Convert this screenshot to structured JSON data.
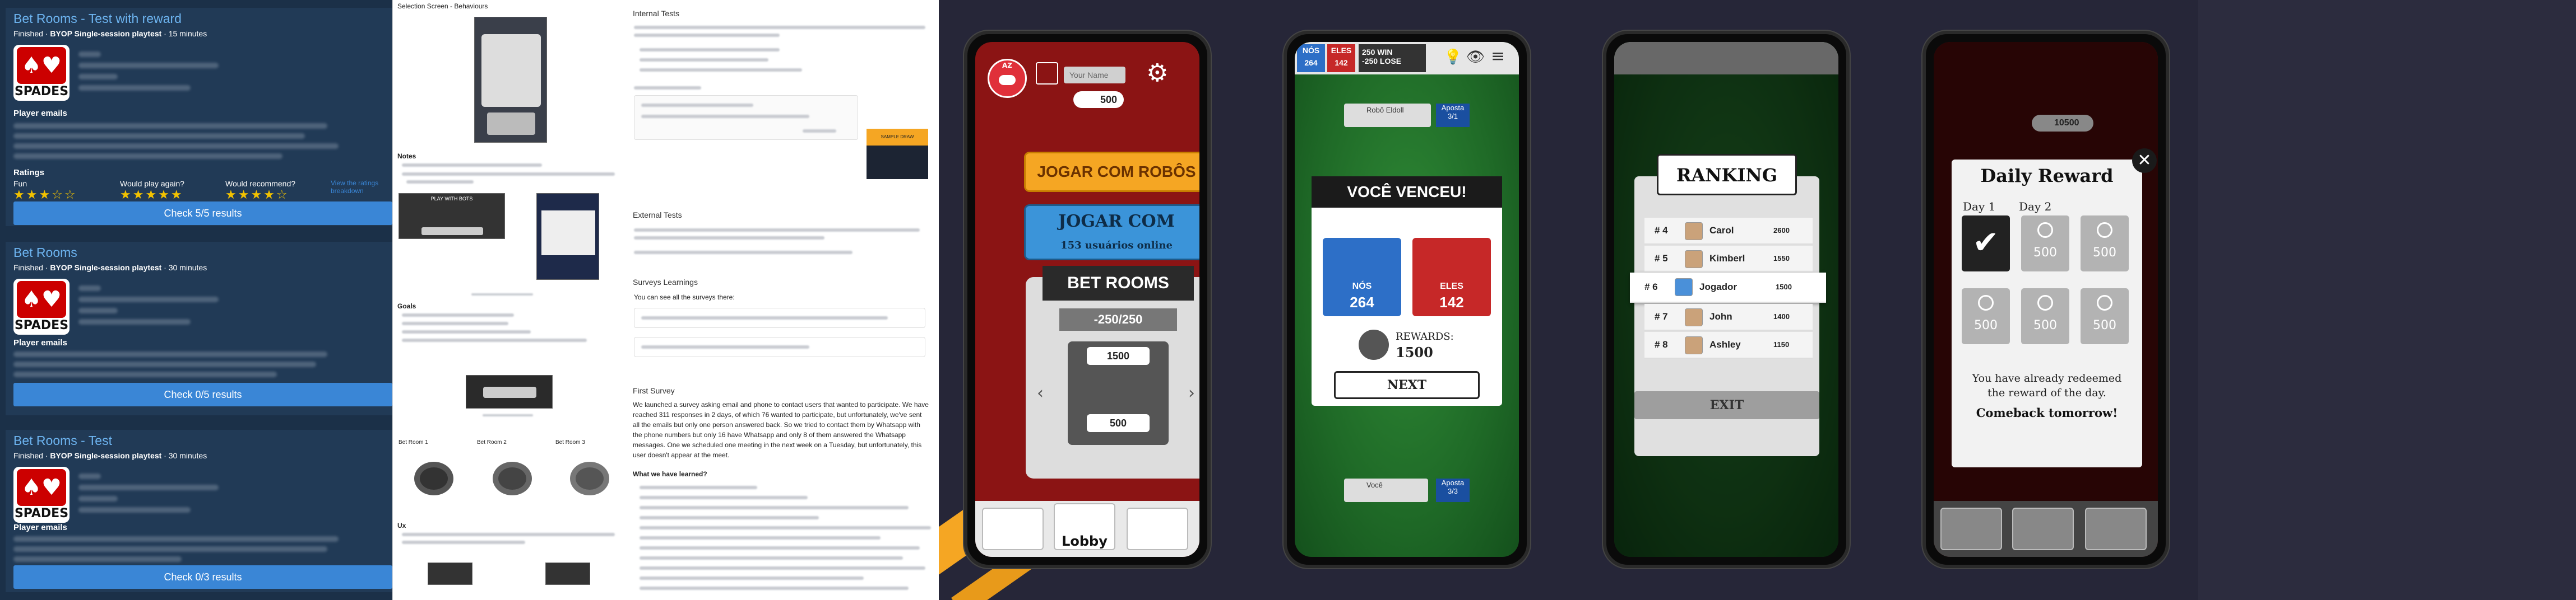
{
  "panel1": {
    "cards": [
      {
        "title": "Bet Rooms - Test with reward",
        "status": "Finished · ",
        "project": "BYOP Single-session playtest",
        "duration": " · 15 minutes",
        "emails_label": "Player emails",
        "has_ratings": true,
        "check": "Check 5/5 results"
      },
      {
        "title": "Bet Rooms",
        "status": "Finished · ",
        "project": "BYOP Single-session playtest",
        "duration": " · 30 minutes",
        "emails_label": "Player emails",
        "has_ratings": false,
        "check": "Check 0/5 results"
      },
      {
        "title": "Bet Rooms - Test",
        "status": "Finished · ",
        "project": "BYOP Single-session playtest",
        "duration": " · 30 minutes",
        "emails_label": "Player emails",
        "has_ratings": false,
        "check": "Check 0/3 results"
      }
    ],
    "logo_text": "SPADES",
    "ratings": {
      "label": "Ratings",
      "fun": "Fun",
      "play_again": "Would play again?",
      "recommend": "Would recommend?",
      "link": "View the ratings breakdown"
    }
  },
  "panel2": {
    "left": {
      "heading": "Selection Screen - Behaviours",
      "notes": "Notes",
      "goals": "Goals",
      "bet_rooms": [
        "Bet Room 1",
        "Bet Room 2",
        "Bet Room 3"
      ],
      "ux": "Ux",
      "mock_label": "PLAY WITH BOTS"
    },
    "right": {
      "internal": "Internal Tests",
      "external": "External Tests",
      "surveys": "Surveys Learnings",
      "surveys_sub": "You can see all the surveys there:",
      "first_survey": "First Survey",
      "first_text": "We launched a survey asking email and phone to contact users that wanted to participate. We have reached 311 responses in 2 days, of which 76 wanted to participate, but unfortunately, we've sent all the emails but only one person answered back. So we tried to contact them by Whatsapp with the phone numbers but only 16 have Whatsapp and only 8 of them answered the Whatsapp messages. One we scheduled one meeting in the next week on a Tuesday, but unfortunately, this user doesn't appear at the meet.",
      "learned": "What we have learned?",
      "sidebox": "SAMPLE DRAW"
    }
  },
  "phone1": {
    "your_name": "Your Name",
    "coins": "500",
    "play_bots": "JOGAR COM ROBÔS",
    "play_online": "JOGAR COM",
    "online_count": "153 usuários online",
    "bet_rooms": "BET ROOMS",
    "bet_range": "-250/250",
    "room_bet": "1500",
    "room_cost": "500",
    "lobby": "Lobby",
    "avatar_tag": "AZ"
  },
  "phone2": {
    "nos_label": "NÓS",
    "nos_score": "264",
    "eles_label": "ELES",
    "eles_score": "142",
    "win": "250 WIN",
    "lose": "-250 LOSE",
    "player": "Robô Eldoll",
    "bet": "Aposta",
    "bet_val": "3/1",
    "you_won": "VOCÊ VENCEU!",
    "score_nos": "264",
    "score_eles": "142",
    "rewards_label": "REWARDS:",
    "rewards_val": "1500",
    "next": "NEXT",
    "you": "Você",
    "your_bet": "3/3"
  },
  "phone3": {
    "title": "RANKING",
    "rows": [
      {
        "rank": "# 4",
        "name": "Carol",
        "score": "2600"
      },
      {
        "rank": "# 5",
        "name": "Kimberl",
        "score": "1550"
      },
      {
        "rank": "# 6",
        "name": "Jogador",
        "score": "1500"
      },
      {
        "rank": "# 7",
        "name": "John",
        "score": "1400"
      },
      {
        "rank": "# 8",
        "name": "Ashley",
        "score": "1150"
      }
    ],
    "exit": "EXIT"
  },
  "phone4": {
    "title": "Daily Reward",
    "day1": "Day 1",
    "day2": "Day 2",
    "slot": "500",
    "msg1": "You have already redeemed",
    "msg2": "the reward of the day.",
    "msg3": "Comeback tomorrow!",
    "coins": "10500"
  },
  "colors": {
    "panel1_bg": "#1b3048",
    "accent_blue": "#3a86d6",
    "felt": "#1f6a27",
    "orange": "#f5a623"
  }
}
